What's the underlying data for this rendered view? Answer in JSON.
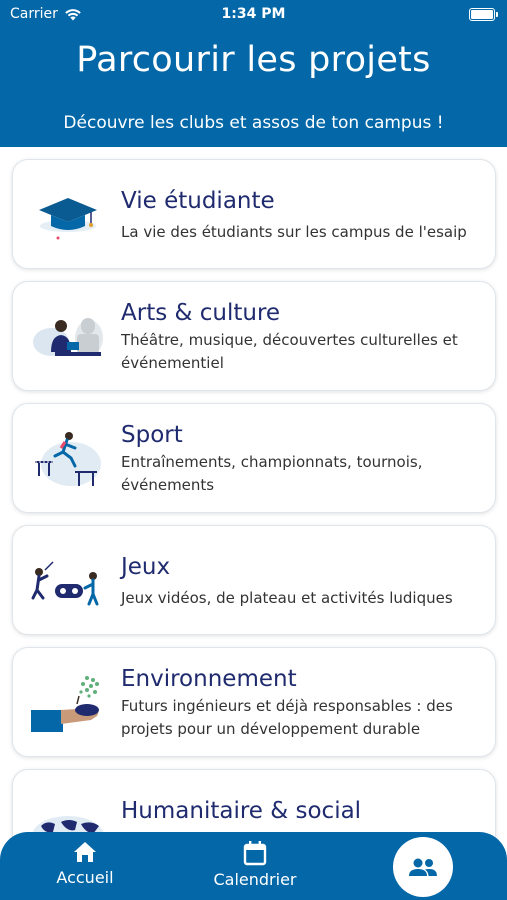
{
  "status_bar": {
    "carrier": "Carrier",
    "time": "1:34 PM"
  },
  "header": {
    "title": "Parcourir les projets",
    "subtitle": "Découvre les clubs et assos de ton campus !"
  },
  "categories": [
    {
      "title": "Vie étudiante",
      "description": "La vie des étudiants sur les campus de l'esaip",
      "icon": "graduation-cap-illustration"
    },
    {
      "title": "Arts & culture",
      "description": "Théâtre, musique, découvertes culturelles et événementiel",
      "icon": "museum-visitor-illustration"
    },
    {
      "title": "Sport",
      "description": "Entraînements, championnats, tournois, événements",
      "icon": "hurdles-runner-illustration"
    },
    {
      "title": "Jeux",
      "description": "Jeux vidéos, de plateau et activités ludiques",
      "icon": "gamepad-players-illustration"
    },
    {
      "title": "Environnement",
      "description": "Futurs ingénieurs et déjà responsables : des projets pour un développement durable",
      "icon": "hand-plant-illustration"
    },
    {
      "title": "Humanitaire & social",
      "description": "",
      "icon": "world-map-illustration"
    }
  ],
  "tabbar": {
    "home_label": "Accueil",
    "calendar_label": "Calendrier",
    "active_tab_icon": "people-icon"
  },
  "colors": {
    "primary": "#0468a8",
    "title_text": "#1f2b6e",
    "card_border": "#dfe5ea"
  }
}
